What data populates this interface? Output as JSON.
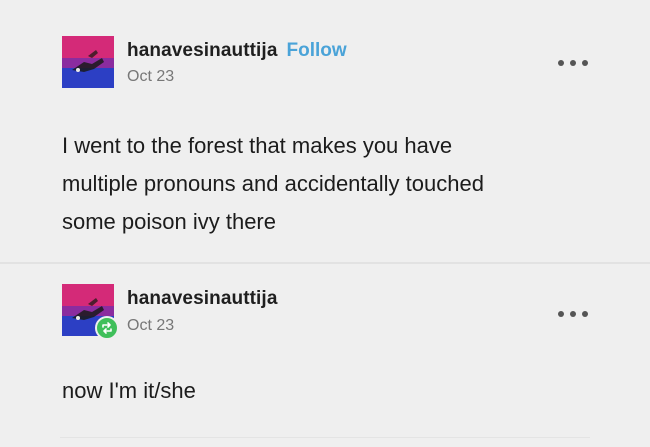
{
  "posts": [
    {
      "username": "hanavesinauttija",
      "follow_label": "Follow",
      "date": "Oct 23",
      "more_icon": "more-horizontal-icon",
      "body_lines": [
        "I went to the forest that makes you have",
        "multiple pronouns and accidentally touched",
        "some poison ivy there"
      ]
    },
    {
      "username": "hanavesinauttija",
      "date": "Oct 23",
      "badge_icon": "reblog-icon",
      "more_icon": "more-horizontal-icon",
      "body_lines": [
        "now I'm it/she"
      ]
    }
  ],
  "colors": {
    "background": "#efefef",
    "follow": "#4aa3d8",
    "badge": "#3fbf5a",
    "avatar_top": "#c4266f",
    "avatar_mid": "#8a2a9c",
    "avatar_bottom": "#2b3fbf"
  }
}
